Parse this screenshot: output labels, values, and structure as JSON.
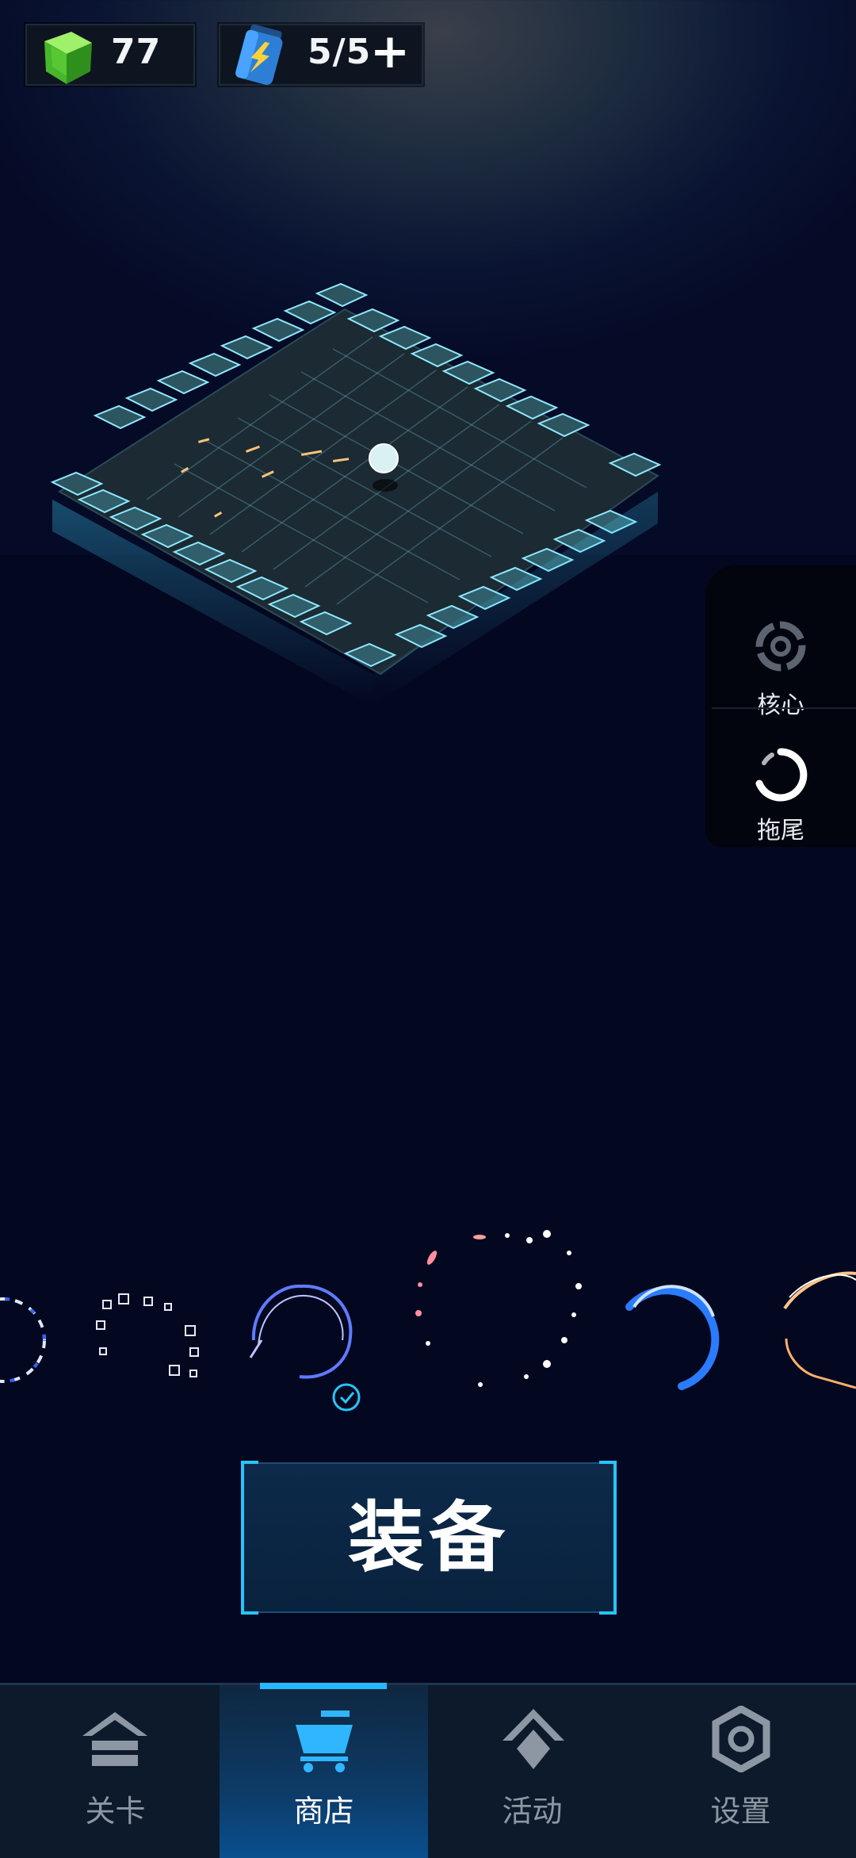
{
  "resources": {
    "gems": "77",
    "energy": "5/5",
    "energy_add": "+"
  },
  "side_menu": {
    "items": [
      {
        "label": "核心",
        "icon": "core-ring-icon"
      },
      {
        "label": "拖尾",
        "icon": "trail-arc-icon"
      }
    ]
  },
  "carousel": {
    "selected_index": 2,
    "items": [
      "trail-chevrons",
      "trail-squares",
      "trail-wave",
      "trail-sparks",
      "trail-blue-arc",
      "trail-fire"
    ]
  },
  "equip_button": {
    "label": "装备"
  },
  "nav": {
    "items": [
      {
        "label": "关卡",
        "icon": "house-icon"
      },
      {
        "label": "商店",
        "icon": "cart-icon",
        "active": true
      },
      {
        "label": "活动",
        "icon": "diamond-icon"
      },
      {
        "label": "设置",
        "icon": "gear-icon"
      }
    ]
  },
  "colors": {
    "accent": "#25c6ff",
    "background": "#04071f",
    "nav_bg": "#0c1a2b",
    "gem": "#5fcf3c"
  }
}
